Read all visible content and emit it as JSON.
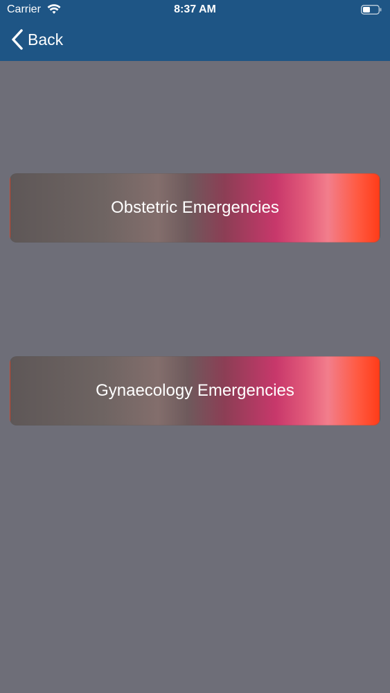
{
  "status_bar": {
    "carrier": "Carrier",
    "time": "8:37 AM",
    "wifi_icon": "wifi-icon",
    "battery_icon": "battery-icon"
  },
  "nav": {
    "back_label": "Back",
    "back_icon": "chevron-left-icon"
  },
  "menu": {
    "items": [
      {
        "label": "Obstetric Emergencies"
      },
      {
        "label": "Gynaecology Emergencies"
      }
    ]
  },
  "colors": {
    "header_bg": "#1e5585",
    "page_bg": "#6e6e78",
    "button_gradient_start": "#5e5757",
    "button_gradient_end": "#ff3c18"
  }
}
